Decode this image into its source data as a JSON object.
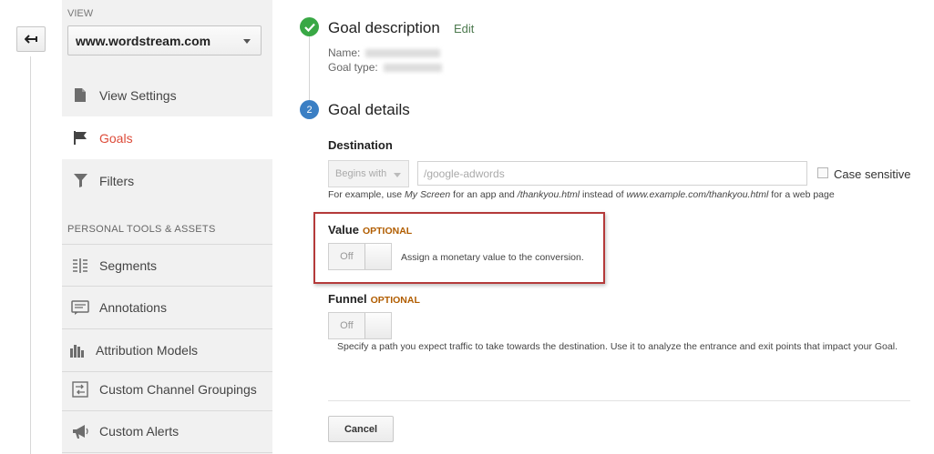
{
  "sidebar": {
    "view_label": "VIEW",
    "view_selected": "www.wordstream.com",
    "items": [
      {
        "label": "View Settings",
        "icon": "document-icon"
      },
      {
        "label": "Goals",
        "icon": "flag-icon"
      },
      {
        "label": "Filters",
        "icon": "funnel-icon"
      }
    ],
    "section_title": "PERSONAL TOOLS & ASSETS",
    "tools": [
      {
        "label": "Segments",
        "icon": "segments-icon"
      },
      {
        "label": "Annotations",
        "icon": "annotation-icon"
      },
      {
        "label": "Attribution Models",
        "icon": "bar-chart-icon"
      },
      {
        "label": "Custom Channel Groupings",
        "icon": "channel-grouping-icon"
      },
      {
        "label": "Custom Alerts",
        "icon": "megaphone-icon"
      }
    ],
    "active_color": "#dd4b39"
  },
  "goal_description": {
    "title": "Goal description",
    "edit_label": "Edit",
    "name_label": "Name:",
    "type_label": "Goal type:"
  },
  "goal_details": {
    "step_number": "2",
    "title": "Goal details",
    "destination": {
      "title": "Destination",
      "match_type": "Begins with",
      "placeholder": "/google-adwords",
      "case_sensitive_label": "Case sensitive",
      "hint_prefix": "For example, use ",
      "hint_em1": "My Screen",
      "hint_mid1": " for an app and ",
      "hint_em2": "/thankyou.html",
      "hint_mid2": " instead of ",
      "hint_em3": "www.example.com/thankyou.html",
      "hint_suffix": " for a web page"
    },
    "value": {
      "title": "Value",
      "optional": "OPTIONAL",
      "toggle_state": "Off",
      "description": "Assign a monetary value to the conversion."
    },
    "funnel": {
      "title": "Funnel",
      "optional": "OPTIONAL",
      "toggle_state": "Off",
      "description": "Specify a path you expect traffic to take towards the destination. Use it to analyze the entrance and exit points that impact your Goal."
    }
  },
  "actions": {
    "cancel_label": "Cancel"
  }
}
